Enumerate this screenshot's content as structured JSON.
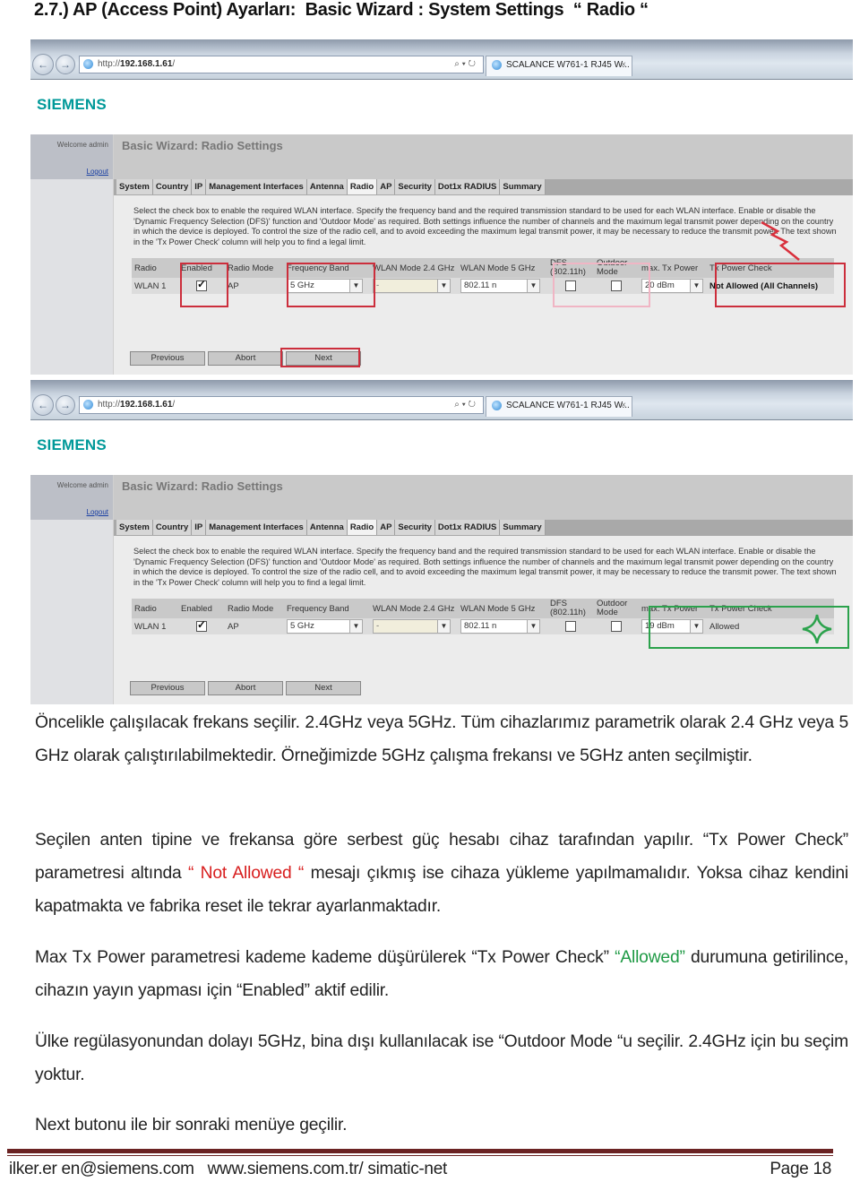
{
  "heading": "2.7.) AP (Access Point) Ayarları:  Basic Wizard : System Settings  “ Radio “",
  "screenshots": [
    {
      "browser": {
        "url_prefix": "http://",
        "url_host": "192.168.1.61",
        "url_suffix": "/",
        "search_icons": "⌕ ▾ ↻",
        "tab_title": "SCALANCE W761-1 RJ45 W...",
        "tab_close": "×"
      },
      "brand": "SIEMENS",
      "sidebar": {
        "welcome": "Welcome admin",
        "logout": "Logout"
      },
      "page_title": "Basic Wizard: Radio Settings",
      "tabs": [
        "System",
        "Country",
        "IP",
        "Management Interfaces",
        "Antenna",
        "Radio",
        "AP",
        "Security",
        "Dot1x RADIUS",
        "Summary"
      ],
      "active_tab": "Radio",
      "description": "Select the check box to enable the required WLAN interface. Specify the frequency band and the required transmission standard to be used for each WLAN interface. Enable or disable the 'Dynamic Frequency Selection (DFS)' function and 'Outdoor Mode' as required. Both settings influence the number of channels and the maximum legal transmit power depending on the country in which the device is deployed. To control the size of the radio cell, and to avoid exceeding the maximum legal transmit power, it may be necessary to reduce the transmit power. The text shown in the 'Tx Power Check' column will help you to find a legal limit.",
      "columns": [
        "Radio",
        "Enabled",
        "Radio Mode",
        "Frequency Band",
        "WLAN Mode 2.4 GHz",
        "WLAN Mode 5 GHz",
        "DFS (802.11h)",
        "Outdoor Mode",
        "max. Tx Power",
        "Tx Power Check"
      ],
      "row": {
        "radio": "WLAN 1",
        "enabled": true,
        "radio_mode": "AP",
        "frequency_band": "5 GHz",
        "wlan_mode_24": "-",
        "wlan_mode_5": "802.11 n",
        "dfs": false,
        "outdoor_mode": false,
        "max_tx_power": "20 dBm",
        "tx_power_check": "Not Allowed (All Channels)"
      },
      "buttons": {
        "previous": "Previous",
        "abort": "Abort",
        "next": "Next"
      },
      "highlight_color": "#cc2e3c"
    },
    {
      "browser": {
        "url_prefix": "http://",
        "url_host": "192.168.1.61",
        "url_suffix": "/",
        "search_icons": "⌕ ▾ ↻",
        "tab_title": "SCALANCE W761-1 RJ45 W...",
        "tab_close": "×"
      },
      "brand": "SIEMENS",
      "sidebar": {
        "welcome": "Welcome admin",
        "logout": "Logout"
      },
      "page_title": "Basic Wizard: Radio Settings",
      "tabs": [
        "System",
        "Country",
        "IP",
        "Management Interfaces",
        "Antenna",
        "Radio",
        "AP",
        "Security",
        "Dot1x RADIUS",
        "Summary"
      ],
      "active_tab": "Radio",
      "description": "Select the check box to enable the required WLAN interface. Specify the frequency band and the required transmission standard to be used for each WLAN interface. Enable or disable the 'Dynamic Frequency Selection (DFS)' function and 'Outdoor Mode' as required. Both settings influence the number of channels and the maximum legal transmit power depending on the country in which the device is deployed. To control the size of the radio cell, and to avoid exceeding the maximum legal transmit power, it may be necessary to reduce the transmit power. The text shown in the 'Tx Power Check' column will help you to find a legal limit.",
      "columns": [
        "Radio",
        "Enabled",
        "Radio Mode",
        "Frequency Band",
        "WLAN Mode 2.4 GHz",
        "WLAN Mode 5 GHz",
        "DFS (802.11h)",
        "Outdoor Mode",
        "max. Tx Power",
        "Tx Power Check"
      ],
      "row": {
        "radio": "WLAN 1",
        "enabled": true,
        "radio_mode": "AP",
        "frequency_band": "5 GHz",
        "wlan_mode_24": "-",
        "wlan_mode_5": "802.11 n",
        "dfs": false,
        "outdoor_mode": false,
        "max_tx_power": "19 dBm",
        "tx_power_check": "Allowed"
      },
      "buttons": {
        "previous": "Previous",
        "abort": "Abort",
        "next": "Next"
      },
      "highlight_color": "#2ba24c"
    }
  ],
  "paragraphs": {
    "p1": "Öncelikle çalışılacak frekans seçilir. 2.4GHz veya 5GHz. Tüm cihazlarımız parametrik olarak 2.4 GHz veya 5 GHz olarak çalıştırılabilmektedir. Örneğimizde 5GHz çalışma frekansı ve 5GHz anten seçilmiştir.",
    "p2_a": "Seçilen anten tipine ve frekansa göre serbest güç hesabı cihaz tarafından yapılır. “Tx Power Check” parametresi altında ",
    "p2_red": "“ Not Allowed “",
    "p2_b": " mesajı çıkmış ise cihaza yükleme yapılmamalıdır. Yoksa cihaz kendini kapatmakta ve fabrika reset ile tekrar ayarlanmaktadır.",
    "p3_a": "Max Tx Power parametresi kademe kademe düşürülerek “Tx Power Check” ",
    "p3_green": "“Allowed”",
    "p3_b": " durumuna getirilince, cihazın yayın yapması için “Enabled” aktif edilir.",
    "p4": "Ülke regülasyonundan dolayı 5GHz, bina dışı kullanılacak ise “Outdoor Mode “u seçilir. 2.4GHz için bu seçim yoktur.",
    "p5": "Next butonu ile bir sonraki menüye geçilir."
  },
  "footer": {
    "contact": "ilker.er en@siemens.com   www.siemens.com.tr/ simatic-net",
    "page": "Page 18"
  }
}
